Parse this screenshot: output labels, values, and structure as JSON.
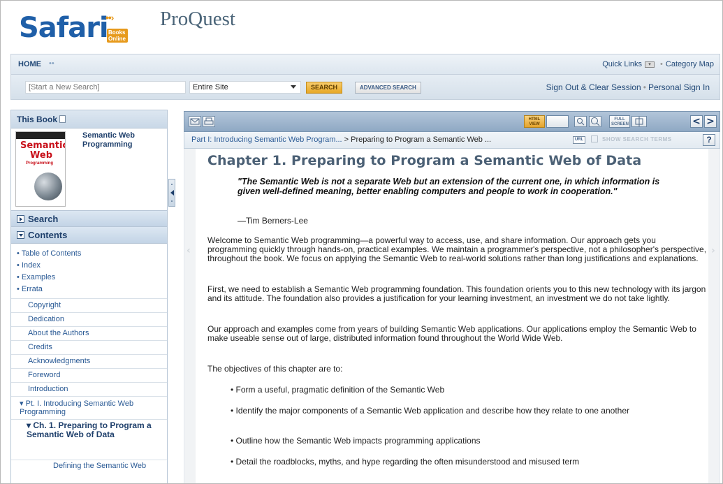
{
  "header": {
    "logo_safari": "Safari",
    "logo_books_online": "Books Online",
    "logo_proquest": "ProQuest"
  },
  "nav": {
    "home": "HOME",
    "quick_links": "Quick Links",
    "category_map": "Category Map"
  },
  "search": {
    "placeholder": "[Start a New Search]",
    "scope_value": "Entire Site",
    "search_button": "SEARCH",
    "advanced_button": "ADVANCED SEARCH",
    "sign_out": "Sign Out & Clear Session",
    "personal_sign_in": "Personal Sign In"
  },
  "sidebar": {
    "this_book": "This Book",
    "book_title": "Semantic Web Programming",
    "cover_line1": "Semantic",
    "cover_line2": "Web",
    "cover_line3": "Programming",
    "search_section": "Search",
    "contents_section": "Contents",
    "content_links": [
      "Table of Contents",
      "Index",
      "Examples",
      "Errata"
    ],
    "toc_items": [
      "Copyright",
      "Dedication",
      "About the Authors",
      "Credits",
      "Acknowledgments",
      "Foreword",
      "Introduction"
    ],
    "toc_part": "Pt. I. Introducing Semantic Web Programming",
    "toc_chapter": "Ch. 1. Preparing to Program a Semantic Web of Data",
    "toc_sub": "Defining the Semantic Web"
  },
  "toolbar": {
    "html_view": "HTML VIEW",
    "full_screen": "FULL SCREEN",
    "prev": "<",
    "next": ">"
  },
  "breadcrumb": {
    "part": "Part I: Introducing Semantic Web Program...",
    "sep": " > ",
    "chapter": "Preparing to Program a Semantic Web ...",
    "url_badge": "URL",
    "show_search_terms": "SHOW SEARCH TERMS",
    "help": "?"
  },
  "content": {
    "chapter_title": "Chapter 1. Preparing to Program a Semantic Web of Data",
    "epigraph": "\"The Semantic Web is not a separate Web but an extension of the current one, in which information is given well-defined meaning, better enabling computers and people to work in cooperation.\"",
    "attribution": "—Tim Berners-Lee",
    "para1": "Welcome to Semantic Web programming—a powerful way to access, use, and share information. Our approach gets you programming quickly through hands-on, practical examples. We maintain a programmer's perspective, not a philosopher's perspective, throughout the book. We focus on applying the Semantic Web to real-world solutions rather than long justifications and explanations.",
    "para2": "First, we need to establish a Semantic Web programming foundation. This foundation orients you to this new technology with its jargon and its attitude. The foundation also provides a justification for your learning investment, an investment we do not take lightly.",
    "para3": "Our approach and examples come from years of building Semantic Web applications. Our applications employ the Semantic Web to make useable sense out of large, distributed information found throughout the World Wide Web.",
    "para4": "The objectives of this chapter are to:",
    "bullets": [
      "Form a useful, pragmatic definition of the Semantic Web",
      "Identify the major components of a Semantic Web application and describe how they relate to one another",
      "Outline how the Semantic Web impacts programming applications",
      "Detail the roadblocks, myths, and hype regarding the often misunderstood and misused term"
    ]
  }
}
